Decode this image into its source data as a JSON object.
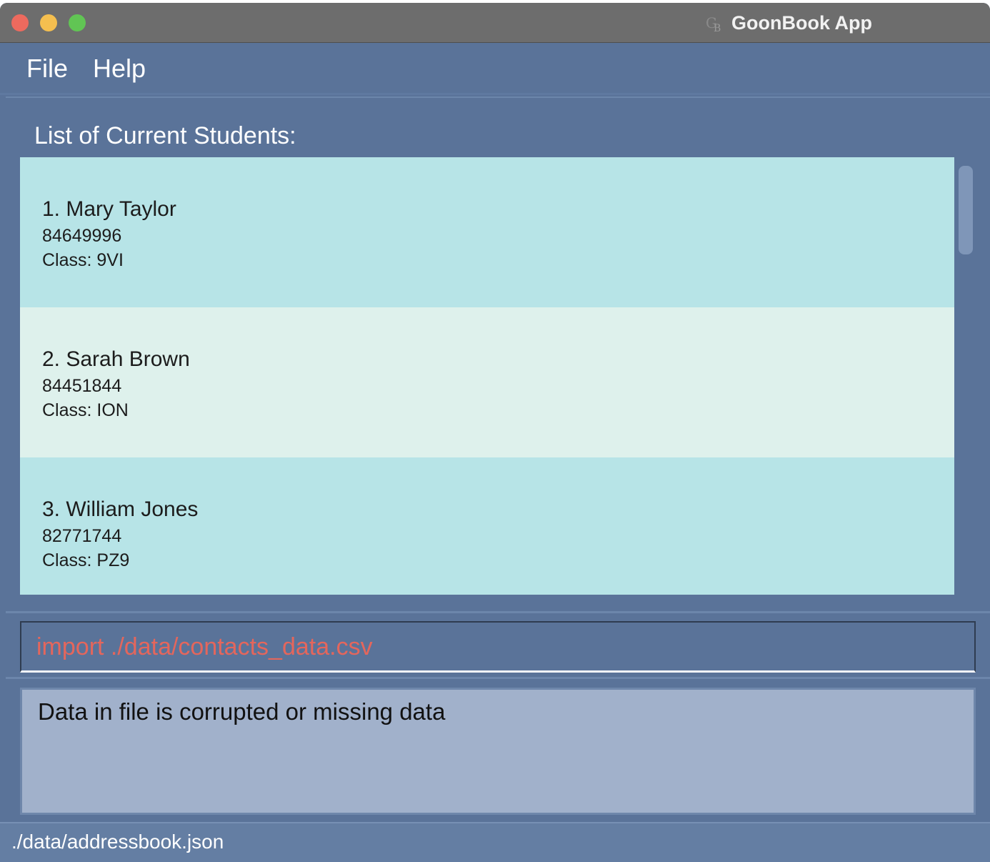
{
  "window": {
    "title": "GoonBook App",
    "icon": "goonbook-logo-icon"
  },
  "menu": {
    "file": "File",
    "help": "Help"
  },
  "list": {
    "heading": "List of Current Students:",
    "students": [
      {
        "name": "1. Mary Taylor",
        "phone": "84649996",
        "class": "Class: 9VI"
      },
      {
        "name": "2. Sarah Brown",
        "phone": "84451844",
        "class": "Class: ION"
      },
      {
        "name": "3. William Jones",
        "phone": "82771744",
        "class": "Class: PZ9"
      }
    ]
  },
  "command": {
    "value": "import ./data/contacts_data.csv"
  },
  "result": {
    "message": "Data in file is corrupted or missing data"
  },
  "status": {
    "path": "./data/addressbook.json"
  },
  "colors": {
    "window_bg": "#5a7399",
    "card_odd": "#b7e4e7",
    "card_even": "#def1ec",
    "command_error_text": "#e4665c",
    "result_bg": "#a1b1cb"
  }
}
